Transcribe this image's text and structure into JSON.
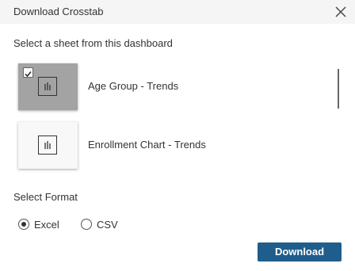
{
  "dialog": {
    "title": "Download Crosstab",
    "close_icon": "close-icon"
  },
  "sheets": {
    "label": "Select a sheet from this dashboard",
    "items": [
      {
        "label": "Age Group - Trends",
        "selected": true,
        "icon": "bar-chart-icon"
      },
      {
        "label": "Enrollment Chart - Trends",
        "selected": false,
        "icon": "bar-chart-icon"
      }
    ]
  },
  "format": {
    "label": "Select Format",
    "options": [
      {
        "label": "Excel",
        "selected": true
      },
      {
        "label": "CSV",
        "selected": false
      }
    ]
  },
  "actions": {
    "download_label": "Download"
  },
  "colors": {
    "primary_button": "#1f5e8c",
    "selected_thumbnail": "#a3a3a3",
    "header_bg": "#f5f5f5"
  }
}
